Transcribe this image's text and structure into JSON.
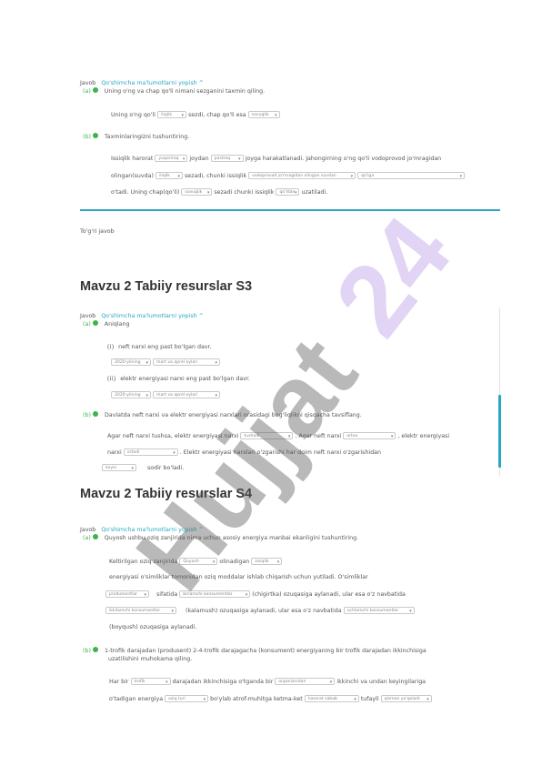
{
  "s1": {
    "javob": "Javob",
    "toggle": "Qo'shimcha ma'lumotlarni yopish ^",
    "a_label": "(a)",
    "a_text": "Uning o'ng va chap qo'li nimani sezganini taxmin qiling.",
    "a_line_pre": "Uning o'ng qo'li",
    "a_sel1": "iliqlik",
    "a_line_mid": "sezdi, chap qo'li esa",
    "a_sel2": "sovuqlik",
    "b_label": "(b)",
    "b_text": "Taxminlaringizni tushuntiring.",
    "b_l1_pre": "Issiqlik harorat",
    "b_sel1": "yuqoriroq",
    "b_l1_mid1": "joydan",
    "b_sel2": "pastroq",
    "b_l1_post": "joyga harakatlanadi. Jahongirning o'ng qo'li vodoprovod jo'mragidan",
    "b_l2_pre": "olingan(suvda)",
    "b_sel3": "iliqlik",
    "b_l2_mid": "sezadi, chunki issiqlik",
    "b_sel4": "vodoprovod jo'mragidan olingan suvdan",
    "b_sel5": "qo'lga",
    "b_l3_pre": "o'tadi. Uning chap(qo'li)",
    "b_sel6": "sovuqlik",
    "b_l3_mid": "sezadi chunki issiqlik",
    "b_sel7": "qo'ldan",
    "b_l3_post": "uzatiladi.",
    "tag": "To'g'ri javob"
  },
  "s2": {
    "title": "Mavzu 2 Tabiiy resurslar S3",
    "javob": "Javob",
    "toggle": "Qo'shimcha ma'lumotlarni yopish ^",
    "a_label": "(a)",
    "a_text": "Aniqlang",
    "i_num": "(i)",
    "i_text": "neft narxi eng past bo'lgan davr.",
    "i_sel1": "2020-yilning",
    "i_sel2": "mart va aprel oylari",
    "ii_num": "(ii)",
    "ii_text": "elektr energiyasi narxi eng past bo'lgan davr.",
    "ii_sel1": "2020-yilning",
    "ii_sel2": "mart va aprel oylari",
    "b_label": "(b)",
    "b_text": "Davlatda neft narxi va elektr energiyasi narxlari orasidagi bog'liqlikni qisqacha tavsiflang.",
    "b_l1_pre": "Agar neft narxi tushsa, elektr energiyasi narxi",
    "b_sel1": "tushadi",
    "b_l1_mid": ". Agar neft narxi",
    "b_sel2": "ortsa",
    "b_l1_post": ", elektr energiyasi",
    "b_l2_pre": "narxi",
    "b_sel3": "ortadi",
    "b_l2_post": ". Elektr energiyasi narxlari o'zgarishi har doim neft narxi o'zgarishidan",
    "b_sel4": "keyin",
    "b_l3_post": "sodir bo'ladi."
  },
  "s3": {
    "title": "Mavzu 2 Tabiiy resurslar S4",
    "javob": "Javob",
    "toggle": "Qo'shimcha ma'lumotlarni yopish ^",
    "a_label": "(a)",
    "a_text": "Quyosh ushbu oziq zanjirida nima uchun asosiy energiya manbai ekanligini tushuntiring.",
    "a_l1_pre": "Keltirilgan oziq zanjirida",
    "a_sel1": "Quyosh",
    "a_l1_mid": "olinadigan",
    "a_sel2": "issiqlik",
    "a_l2": "energiyasi o'simliklar tomonidan oziq moddalar ishlab chiqarish uchun yutiladi. O'simliklar",
    "a_sel3": "produtsentlar",
    "a_l3_mid": "sifatida",
    "a_sel4": "birlamchi konsumentlar",
    "a_l3_post": "(chigirtka) ozuqasiga aylanadi, ular esa o'z navbatida",
    "a_sel5": "ikkilamchi konsumentlar",
    "a_l4_mid": "(kalamush) ozuqasiga aylanadi, ular esa o'z navbatida",
    "a_sel6": "uchlamchi konsumentlar",
    "a_l5": "(boyqush) ozuqasiga aylanadi.",
    "b_label": "(b)",
    "b_text1": "1-trofik darajadan (produsent) 2-4-trofik darajagacha (konsument) energiyaning bir trofik darajadan ikkinchisiga",
    "b_text2": "uzatilishini muhokama qiling.",
    "b_l1_pre": "Har bir",
    "b_sel1": "trofik",
    "b_l1_mid": "darajadan ikkinchisiga o'tganda bir",
    "b_sel2": "organizmdan",
    "b_l1_post": "ikkinchi va undan keyingilariga",
    "b_l2_pre": "o'tadigan energiya",
    "b_sel3": "oziq turi",
    "b_l2_mid": "bo'ylab atrof-muhitga ketma-ket",
    "b_sel4": "harorat sabab",
    "b_l2_mid2": "tufayli",
    "b_sel5": "qisman yo'qoladi"
  },
  "watermark": "Hujjat 24"
}
